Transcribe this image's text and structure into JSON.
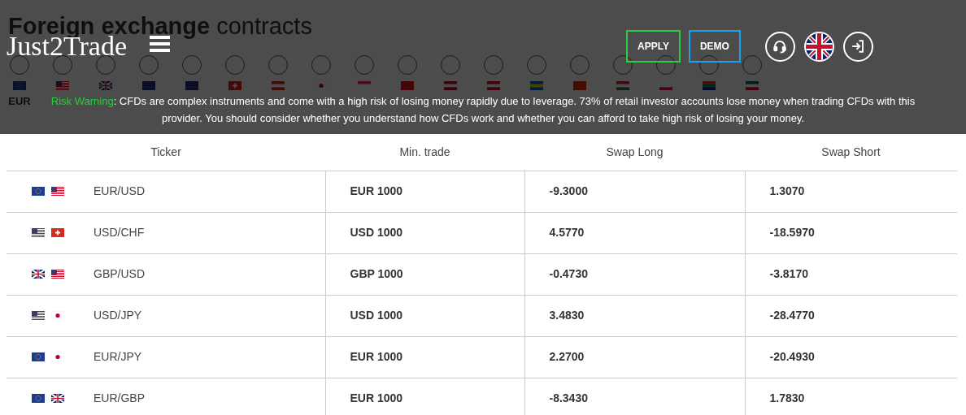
{
  "page_title": {
    "bold": "Foreign exchange",
    "light": "contracts"
  },
  "currencies": [
    {
      "kind": "eu",
      "code": "EUR"
    },
    {
      "kind": "us"
    },
    {
      "kind": "gb"
    },
    {
      "kind": "au"
    },
    {
      "kind": "nz"
    },
    {
      "kind": "ch"
    },
    {
      "kind": "ca"
    },
    {
      "kind": "jp"
    },
    {
      "kind": "sg"
    },
    {
      "kind": "tr"
    },
    {
      "kind": "no"
    },
    {
      "kind": "dk"
    },
    {
      "kind": "se"
    },
    {
      "kind": "hk"
    },
    {
      "kind": "hu"
    },
    {
      "kind": "pl"
    },
    {
      "kind": "za"
    },
    {
      "kind": "mx"
    }
  ],
  "header": {
    "logo": "Just2Trade",
    "buttons": [
      {
        "label": "APPLY",
        "color": "#2ecc40"
      },
      {
        "label": "DEMO",
        "color": "#1ea0f0"
      }
    ]
  },
  "risk_warning": {
    "label": "Risk Warning",
    "text": ": CFDs are complex instruments and come with a high risk of losing money rapidly due to leverage. 73% of retail investor accounts lose money when trading CFDs with this provider. You should consider whether you understand how CFDs work and whether you can afford to take high risk of losing your money."
  },
  "table": {
    "columns": [
      "Ticker",
      "Min. trade",
      "Swap Long",
      "Swap Short"
    ],
    "rows": [
      {
        "flags": [
          {
            "kind": "eu"
          },
          {
            "kind": "us"
          }
        ],
        "ticker": "EUR/USD",
        "min_trade": "EUR 1000",
        "swap_long": "-9.3000",
        "swap_short": "1.3070"
      },
      {
        "flags": [
          {
            "kind": "us"
          },
          {
            "kind": "ch"
          }
        ],
        "ticker": "USD/CHF",
        "min_trade": "USD 1000",
        "swap_long": "4.5770",
        "swap_short": "-18.5970"
      },
      {
        "flags": [
          {
            "kind": "gb"
          },
          {
            "kind": "us"
          }
        ],
        "ticker": "GBP/USD",
        "min_trade": "GBP 1000",
        "swap_long": "-0.4730",
        "swap_short": "-3.8170"
      },
      {
        "flags": [
          {
            "kind": "us"
          },
          {
            "kind": "jp"
          }
        ],
        "ticker": "USD/JPY",
        "min_trade": "USD 1000",
        "swap_long": "3.4830",
        "swap_short": "-28.4770"
      },
      {
        "flags": [
          {
            "kind": "eu"
          },
          {
            "kind": "jp"
          }
        ],
        "ticker": "EUR/JPY",
        "min_trade": "EUR 1000",
        "swap_long": "2.2700",
        "swap_short": "-20.4930"
      },
      {
        "flags": [
          {
            "kind": "eu"
          },
          {
            "kind": "gb"
          }
        ],
        "ticker": "EUR/GBP",
        "min_trade": "EUR 1000",
        "swap_long": "-8.3430",
        "swap_short": "1.7830"
      }
    ]
  }
}
